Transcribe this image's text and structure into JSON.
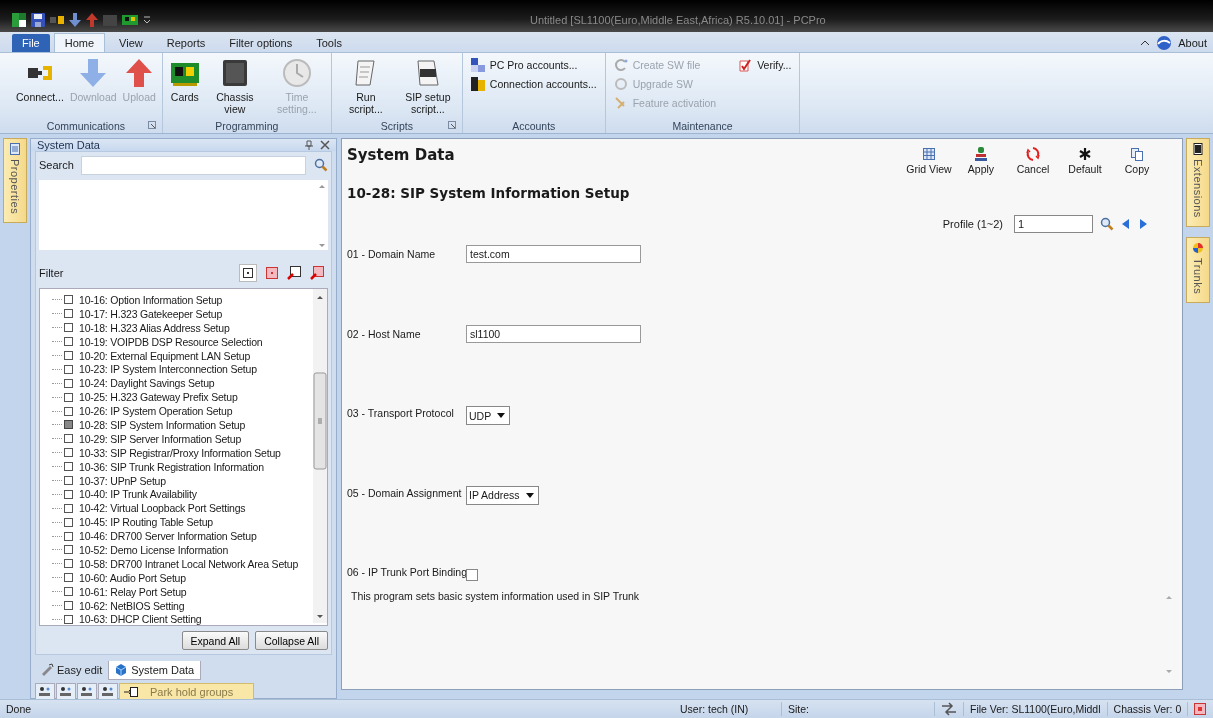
{
  "window": {
    "title": "Untitled [SL1100(Euro,Middle East,Africa) R5.10.01] - PCPro"
  },
  "ribbon": {
    "tabs": [
      {
        "label": "File",
        "kind": "file",
        "selected": false
      },
      {
        "label": "Home",
        "kind": "tab",
        "selected": true
      },
      {
        "label": "View",
        "kind": "tab",
        "selected": false
      },
      {
        "label": "Reports",
        "kind": "tab",
        "selected": false
      },
      {
        "label": "Filter options",
        "kind": "tab",
        "selected": false
      },
      {
        "label": "Tools",
        "kind": "tab",
        "selected": false
      }
    ],
    "about": "About",
    "groups": [
      {
        "label": "Communications",
        "launcher": true,
        "kind": "large",
        "buttons": [
          {
            "label": "Connect...",
            "disabled": false
          },
          {
            "label": "Download",
            "disabled": true
          },
          {
            "label": "Upload",
            "disabled": true
          }
        ]
      },
      {
        "label": "Programming",
        "launcher": false,
        "kind": "large",
        "buttons": [
          {
            "label": "Cards",
            "disabled": false
          },
          {
            "label": "Chassis view",
            "disabled": false
          },
          {
            "label": "Time setting...",
            "disabled": true
          }
        ]
      },
      {
        "label": "Scripts",
        "launcher": true,
        "kind": "large",
        "buttons": [
          {
            "label": "Run script...",
            "disabled": false
          },
          {
            "label": "SIP setup script...",
            "disabled": false
          }
        ]
      },
      {
        "label": "Accounts",
        "launcher": false,
        "kind": "small",
        "buttons": [
          {
            "label": "PC Pro accounts...",
            "disabled": false
          },
          {
            "label": "Connection accounts...",
            "disabled": false
          }
        ]
      },
      {
        "label": "Maintenance",
        "launcher": false,
        "kind": "small",
        "buttons": [
          {
            "label": "Create SW file",
            "disabled": true
          },
          {
            "label": "Upgrade SW",
            "disabled": true
          },
          {
            "label": "Feature activation",
            "disabled": true
          },
          {
            "label": "Verify...",
            "disabled": false
          }
        ]
      }
    ]
  },
  "side_tabs_left": [
    {
      "label": "Properties"
    }
  ],
  "left_panel": {
    "title": "System Data",
    "search_label": "Search",
    "filter_label": "Filter",
    "tree": [
      {
        "label": "10-16: Option Information Setup",
        "selected": false
      },
      {
        "label": "10-17: H.323 Gatekeeper Setup",
        "selected": false
      },
      {
        "label": "10-18: H.323 Alias Address Setup",
        "selected": false
      },
      {
        "label": "10-19: VOIPDB DSP Resource Selection",
        "selected": false
      },
      {
        "label": "10-20: External Equipment LAN Setup",
        "selected": false
      },
      {
        "label": "10-23: IP System Interconnection Setup",
        "selected": false
      },
      {
        "label": "10-24: Daylight Savings Setup",
        "selected": false
      },
      {
        "label": "10-25: H.323 Gateway Prefix Setup",
        "selected": false
      },
      {
        "label": "10-26: IP System Operation Setup",
        "selected": false
      },
      {
        "label": "10-28: SIP System Information Setup",
        "selected": true
      },
      {
        "label": "10-29: SIP Server Information Setup",
        "selected": false
      },
      {
        "label": "10-33: SIP Registrar/Proxy Information Setup",
        "selected": false
      },
      {
        "label": "10-36: SIP Trunk Registration Information",
        "selected": false
      },
      {
        "label": "10-37: UPnP Setup",
        "selected": false
      },
      {
        "label": "10-40: IP Trunk Availability",
        "selected": false
      },
      {
        "label": "10-42: Virtual Loopback Port Settings",
        "selected": false
      },
      {
        "label": "10-45: IP Routing Table Setup",
        "selected": false
      },
      {
        "label": "10-46: DR700 Server Information Setup",
        "selected": false
      },
      {
        "label": "10-52: Demo License Information",
        "selected": false
      },
      {
        "label": "10-58: DR700 Intranet Local Network Area Setup",
        "selected": false
      },
      {
        "label": "10-60: Audio Port Setup",
        "selected": false
      },
      {
        "label": "10-61: Relay Port Setup",
        "selected": false
      },
      {
        "label": "10-62: NetBIOS Setting",
        "selected": false
      },
      {
        "label": "10-63: DHCP Client Setting",
        "selected": false
      }
    ],
    "buttons": [
      "Expand All",
      "Collapse All"
    ],
    "bottom_tabs": [
      {
        "label": "Easy edit",
        "selected": false
      },
      {
        "label": "System Data",
        "selected": true
      }
    ],
    "quick_group": "Park hold groups"
  },
  "content": {
    "title": "System Data",
    "toolbar": [
      "Grid View",
      "Apply",
      "Cancel",
      "Default",
      "Copy"
    ],
    "subtitle": "10-28: SIP System Information Setup",
    "profile_label": "Profile (1~2)",
    "profile_value": "1",
    "fields": [
      {
        "label": "01 - Domain Name",
        "kind": "text",
        "value": "test.com"
      },
      {
        "label": "02 - Host Name",
        "kind": "text",
        "value": "sl1100"
      },
      {
        "label": "03 - Transport Protocol",
        "kind": "select",
        "value": "UDP"
      },
      {
        "label": "05 - Domain Assignment",
        "kind": "select",
        "value": "IP Address"
      },
      {
        "label": "06 - IP Trunk Port Binding",
        "kind": "checkbox",
        "checked": false
      }
    ],
    "description": "This program sets basic system information used in SIP Trunk"
  },
  "side_tabs_right": [
    {
      "label": "Extensions"
    },
    {
      "label": "Trunks"
    }
  ],
  "status_bar": [
    "Done",
    "User: tech (IN)",
    "Site:",
    "File Ver: SL1100(Euro,Middl",
    "Chassis Ver: 0"
  ]
}
